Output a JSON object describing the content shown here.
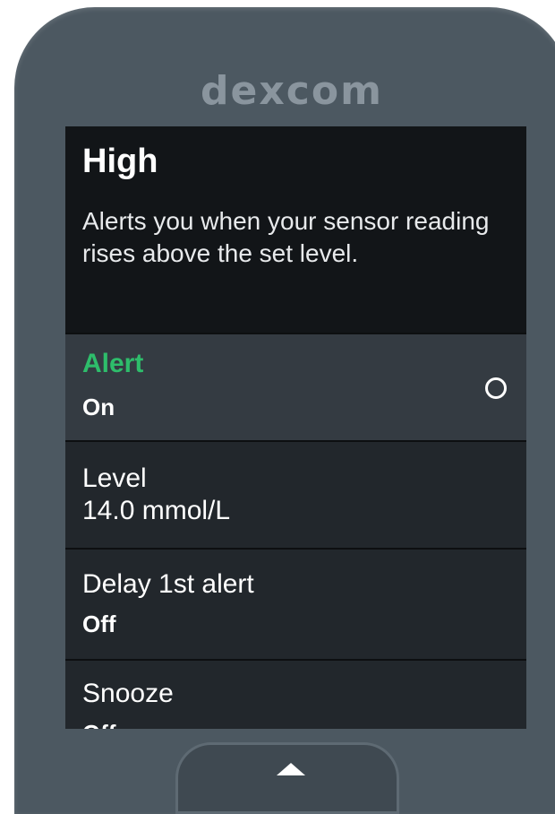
{
  "device": {
    "brand": "Dexcom"
  },
  "screen": {
    "title": "High",
    "description": "Alerts you when your sensor reading rises above the set level.",
    "settings": [
      {
        "label": "Alert",
        "value": "On"
      },
      {
        "label": "Level",
        "value": "14.0 mmol/L"
      },
      {
        "label": "Delay 1st alert",
        "value": "Off"
      },
      {
        "label": "Snooze",
        "value": "Off"
      }
    ]
  },
  "colors": {
    "accent_green": "#2ebd6b",
    "device_body": "#4c5861",
    "screen_bg": "#121518",
    "row_bg": "#22272c",
    "row_selected_bg": "#343b42"
  },
  "icons": {
    "alert_toggle": "radio-circle-icon",
    "nav_up": "arrow-up-icon"
  }
}
